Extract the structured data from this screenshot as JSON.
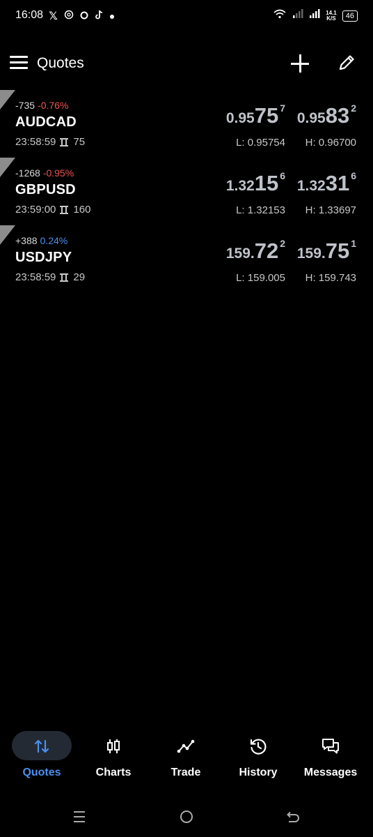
{
  "statusbar": {
    "time": "16:08",
    "left_icons": [
      "x-icon",
      "openai-icon",
      "circle-icon",
      "tiktok-icon",
      "dot-icon"
    ],
    "netspeed_value": "14.1",
    "netspeed_unit": "K/S",
    "battery": "46"
  },
  "header": {
    "title": "Quotes"
  },
  "quotes": [
    {
      "change_points": "-735",
      "change_pct": "-0.76%",
      "change_color": "#ef5350",
      "symbol": "AUDCAD",
      "time": "23:58:59",
      "spread": "75",
      "bid_small": "0.95",
      "bid_big": "75",
      "bid_sup": "7",
      "ask_small": "0.95",
      "ask_big": "83",
      "ask_sup": "2",
      "low": "L: 0.95754",
      "high": "H: 0.96700"
    },
    {
      "change_points": "-1268",
      "change_pct": "-0.95%",
      "change_color": "#ef5350",
      "symbol": "GBPUSD",
      "time": "23:59:00",
      "spread": "160",
      "bid_small": "1.32",
      "bid_big": "15",
      "bid_sup": "6",
      "ask_small": "1.32",
      "ask_big": "31",
      "ask_sup": "6",
      "low": "L: 1.32153",
      "high": "H: 1.33697"
    },
    {
      "change_points": "+388",
      "change_pct": "0.24%",
      "change_color": "#4a8ff0",
      "symbol": "USDJPY",
      "time": "23:58:59",
      "spread": "29",
      "bid_small": "159.",
      "bid_big": "72",
      "bid_sup": "2",
      "ask_small": "159.",
      "ask_big": "75",
      "ask_sup": "1",
      "low": "L: 159.005",
      "high": "H: 159.743"
    }
  ],
  "bottomnav": {
    "items": [
      {
        "label": "Quotes",
        "icon": "arrows-up-down-icon",
        "active": true
      },
      {
        "label": "Charts",
        "icon": "candlestick-icon",
        "active": false
      },
      {
        "label": "Trade",
        "icon": "trend-line-icon",
        "active": false
      },
      {
        "label": "History",
        "icon": "history-icon",
        "active": false
      },
      {
        "label": "Messages",
        "icon": "messages-icon",
        "active": false
      }
    ],
    "active_color": "#4a8ff0"
  },
  "sysnav": {
    "buttons": [
      "recents-icon",
      "home-icon",
      "back-icon"
    ]
  }
}
